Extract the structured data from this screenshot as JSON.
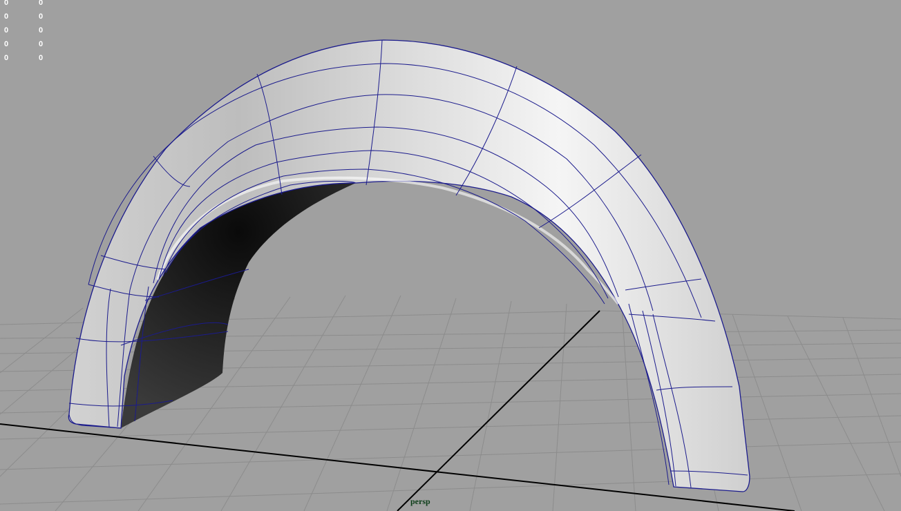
{
  "viewport": {
    "camera_name": "persp",
    "background_color": "#a0a0a0",
    "grid_color": "#8a8a8a",
    "axis_color": "#000000",
    "wireframe_color": "#1b1b8c"
  },
  "hud": {
    "rows": [
      {
        "col1": "0",
        "col2": "0"
      },
      {
        "col1": "0",
        "col2": "0"
      },
      {
        "col1": "0",
        "col2": "0"
      },
      {
        "col1": "0",
        "col2": "0"
      },
      {
        "col1": "0",
        "col2": "0"
      }
    ]
  }
}
